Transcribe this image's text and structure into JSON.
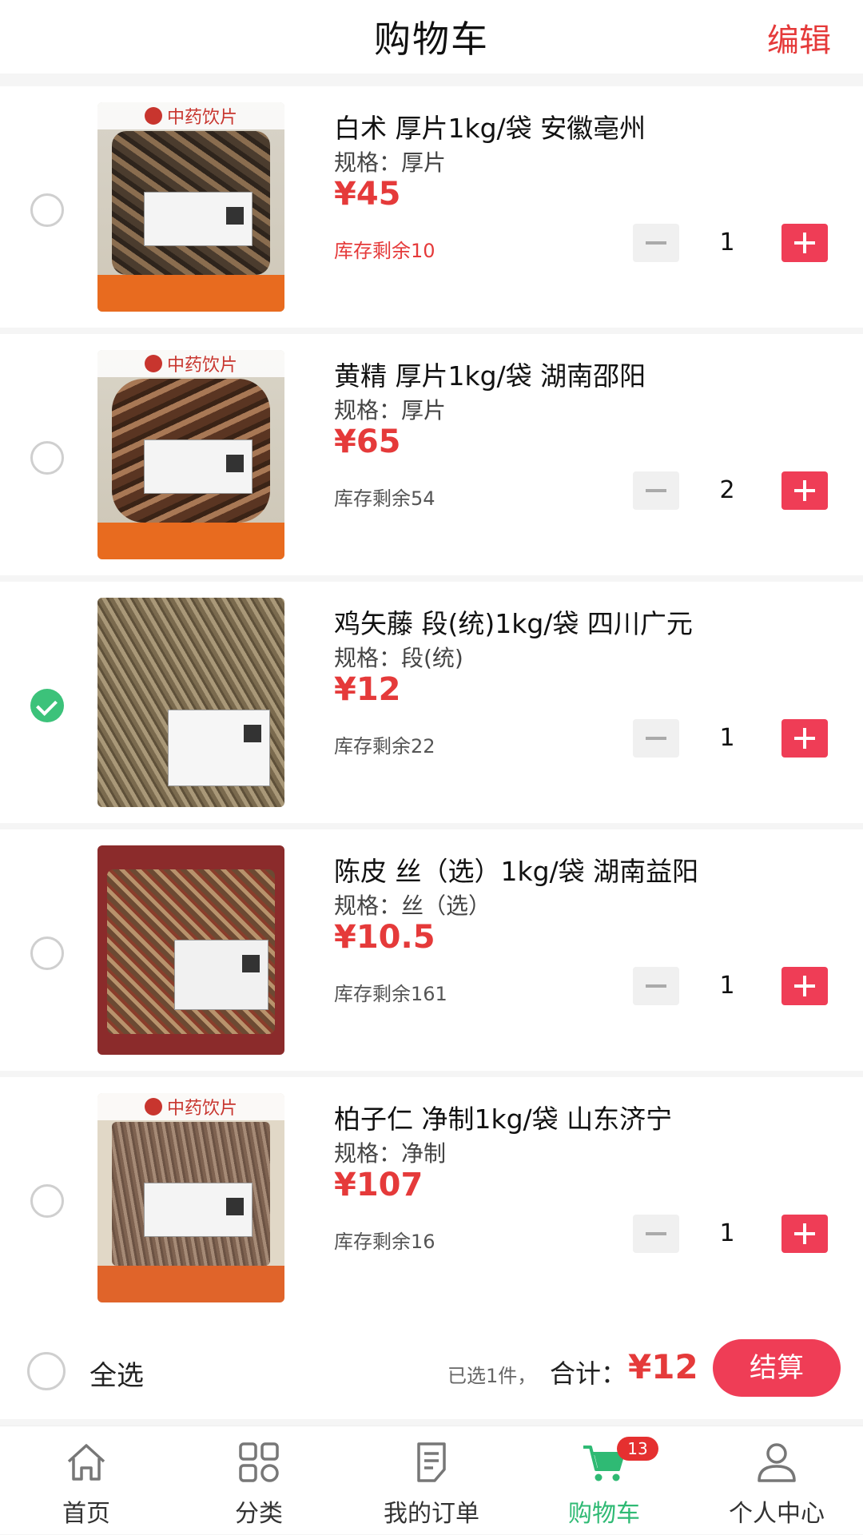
{
  "header": {
    "title": "购物车",
    "edit_label": "编辑"
  },
  "product_image": {
    "brand_text": "中药饮片"
  },
  "cart_items": [
    {
      "name": "白术 厚片1kg/袋 安徽亳州",
      "spec": "规格：厚片",
      "price": "¥45",
      "stock": "库存剩余10",
      "quantity": "1",
      "selected": false,
      "low_stock": true
    },
    {
      "name": "黄精 厚片1kg/袋 湖南邵阳",
      "spec": "规格：厚片",
      "price": "¥65",
      "stock": "库存剩余54",
      "quantity": "2",
      "selected": false,
      "low_stock": false
    },
    {
      "name": "鸡矢藤 段(统)1kg/袋 四川广元",
      "spec": "规格：段(统)",
      "price": "¥12",
      "stock": "库存剩余22",
      "quantity": "1",
      "selected": true,
      "low_stock": false
    },
    {
      "name": "陈皮 丝（选）1kg/袋 湖南益阳",
      "spec": "规格：丝（选）",
      "price": "¥10.5",
      "stock": "库存剩余161",
      "quantity": "1",
      "selected": false,
      "low_stock": false
    },
    {
      "name": "柏子仁 净制1kg/袋 山东济宁",
      "spec": "规格：净制",
      "price": "¥107",
      "stock": "库存剩余16",
      "quantity": "1",
      "selected": false,
      "low_stock": false
    }
  ],
  "footer": {
    "select_all_label": "全选",
    "selected_count_text": "已选1件，",
    "total_label": "合计：",
    "total_value": "¥12",
    "checkout_label": "结算"
  },
  "tabbar": {
    "items": [
      {
        "label": "首页",
        "icon": "home-icon"
      },
      {
        "label": "分类",
        "icon": "grid-icon"
      },
      {
        "label": "我的订单",
        "icon": "document-icon"
      },
      {
        "label": "购物车",
        "icon": "cart-icon",
        "active": true
      },
      {
        "label": "个人中心",
        "icon": "user-icon"
      }
    ],
    "cart_badge": "13"
  },
  "colors": {
    "accent": "#e53a3a",
    "button": "#ef3d56",
    "active_tab": "#2fba74",
    "checked": "#3cc27a"
  }
}
